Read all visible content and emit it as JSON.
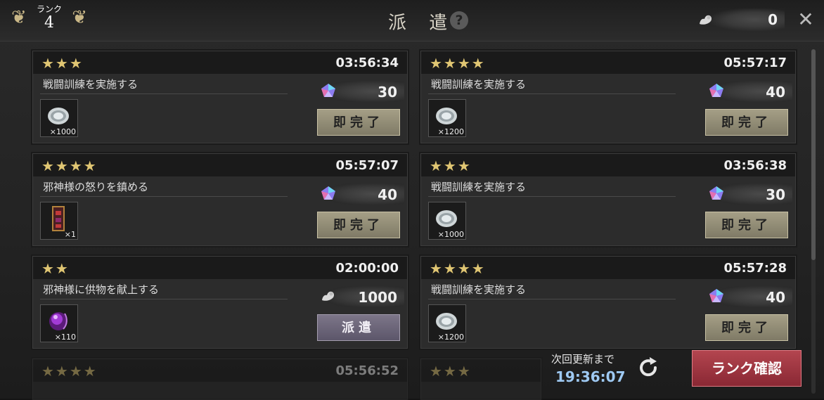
{
  "header": {
    "rank_label": "ランク",
    "rank_value": "4",
    "title": "派 遣",
    "help": "?",
    "stamina_value": "0",
    "close": "✕"
  },
  "missions": [
    {
      "stars": "★★★",
      "time": "03:56:34",
      "name": "戦闘訓練を実施する",
      "cost_icon": "gem-icon",
      "cost": "30",
      "item_qty": "×1000",
      "item_icon": "silver-coin-icon",
      "button": "即完了"
    },
    {
      "stars": "★★★★",
      "time": "05:57:17",
      "name": "戦闘訓練を実施する",
      "cost_icon": "gem-icon",
      "cost": "40",
      "item_qty": "×1200",
      "item_icon": "silver-coin-icon",
      "button": "即完了"
    },
    {
      "stars": "★★★★",
      "time": "05:57:07",
      "name": "邪神様の怒りを鎮める",
      "cost_icon": "gem-icon",
      "cost": "40",
      "item_qty": "×1",
      "item_icon": "scroll-item-icon",
      "button": "即完了"
    },
    {
      "stars": "★★★",
      "time": "03:56:38",
      "name": "戦闘訓練を実施する",
      "cost_icon": "gem-icon",
      "cost": "30",
      "item_qty": "×1000",
      "item_icon": "silver-coin-icon",
      "button": "即完了"
    },
    {
      "stars": "★★",
      "time": "02:00:00",
      "name": "邪神様に供物を献上する",
      "cost_icon": "arm-icon",
      "cost": "1000",
      "item_qty": "×110",
      "item_icon": "purple-orb-icon",
      "button": "派遣"
    },
    {
      "stars": "★★★★",
      "time": "05:57:28",
      "name": "戦闘訓練を実施する",
      "cost_icon": "gem-icon",
      "cost": "40",
      "item_qty": "×1200",
      "item_icon": "silver-coin-icon",
      "button": "即完了"
    },
    {
      "stars": "★★★★",
      "time": "05:56:52"
    },
    {
      "stars": "★★★"
    }
  ],
  "footer": {
    "refresh_label": "次回更新まで",
    "refresh_time": "19:36:07",
    "rank_button": "ランク確認"
  },
  "colors": {
    "star": "#e0c673",
    "complete_button": "#a59f86",
    "dispatch_button": "#7d7689",
    "rank_button": "#b3454f",
    "refresh_time": "#9ec9f2"
  }
}
